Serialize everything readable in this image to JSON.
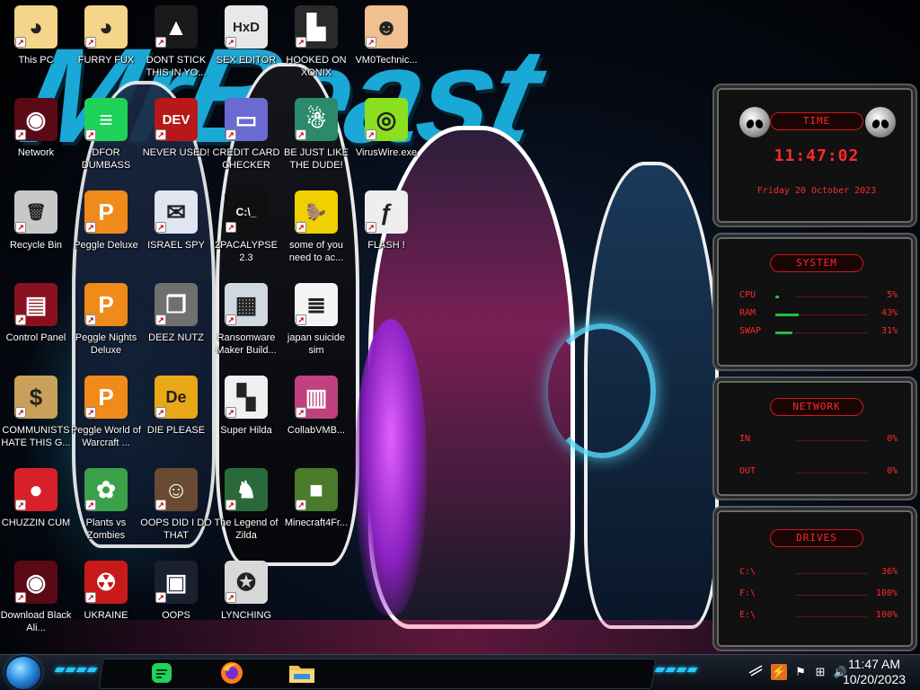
{
  "wallpaper": {
    "title_text": "MrBeast"
  },
  "desktop_icons": [
    {
      "id": "this-pc",
      "label": "This PC",
      "icon": "cartoon-face-icon",
      "col": 0,
      "row": 0
    },
    {
      "id": "network",
      "label": "Network",
      "icon": "alienware-orb-icon",
      "col": 0,
      "row": 1
    },
    {
      "id": "recycle-bin",
      "label": "Recycle Bin",
      "icon": "trash-can-icon",
      "col": 0,
      "row": 2
    },
    {
      "id": "control-panel",
      "label": "Control Panel",
      "icon": "control-panel-icon",
      "col": 0,
      "row": 3
    },
    {
      "id": "communists",
      "label": "COMMUNISTS HATE THIS G...",
      "icon": "money-bag-icon",
      "col": 0,
      "row": 4
    },
    {
      "id": "chuzzin-cum",
      "label": "CHUZZIN CUM",
      "icon": "red-fuzzball-icon",
      "col": 0,
      "row": 5
    },
    {
      "id": "download-black-ali",
      "label": "Download Black Ali...",
      "icon": "alienware-orb-icon",
      "col": 0,
      "row": 6
    },
    {
      "id": "furry-fux",
      "label": "FURRY FUX",
      "icon": "cartoon-face-icon",
      "col": 1,
      "row": 0
    },
    {
      "id": "dfor-dumbass",
      "label": "DFOR DUMBASS",
      "icon": "green-chat-icon",
      "col": 1,
      "row": 1
    },
    {
      "id": "peggle-deluxe",
      "label": "Peggle Deluxe",
      "icon": "peggle-icon",
      "col": 1,
      "row": 2
    },
    {
      "id": "peggle-nights",
      "label": "Peggle Nights Deluxe",
      "icon": "peggle-icon",
      "col": 1,
      "row": 3
    },
    {
      "id": "peggle-world",
      "label": "Peggle World of Warcraft ...",
      "icon": "peggle-icon",
      "col": 1,
      "row": 4
    },
    {
      "id": "plants-vs-zombies",
      "label": "Plants vs Zombies",
      "icon": "flower-icon",
      "col": 1,
      "row": 5
    },
    {
      "id": "ukraine",
      "label": "UKRAINE",
      "icon": "radiation-icon",
      "col": 1,
      "row": 6
    },
    {
      "id": "dont-stick",
      "label": "DONT STICK THIS IN YO...",
      "icon": "traffic-cone-icon",
      "col": 2,
      "row": 0
    },
    {
      "id": "never-used",
      "label": "NEVER USED!",
      "icon": "dev-cpp-icon",
      "col": 2,
      "row": 1
    },
    {
      "id": "israel-spy",
      "label": "ISRAEL SPY",
      "icon": "envelope-icon",
      "col": 2,
      "row": 2
    },
    {
      "id": "deez-nutz",
      "label": "DEEZ NUTZ",
      "icon": "stacked-windows-icon",
      "col": 2,
      "row": 3
    },
    {
      "id": "die-please",
      "label": "DIE PLEASE",
      "icon": "de-icon",
      "col": 2,
      "row": 4
    },
    {
      "id": "oops-did-i",
      "label": "OOPS DID I DO THAT",
      "icon": "portrait-icon",
      "col": 2,
      "row": 5
    },
    {
      "id": "oops",
      "label": "OOPS",
      "icon": "monitor-icon",
      "col": 2,
      "row": 6
    },
    {
      "id": "sex-editor",
      "label": "SEX EDITOR",
      "icon": "hxd-icon",
      "col": 3,
      "row": 0
    },
    {
      "id": "credit-card",
      "label": "CREDIT CARD CHECKER",
      "icon": "credit-card-icon",
      "col": 3,
      "row": 1
    },
    {
      "id": "2pacalypse",
      "label": "2PACALYPSE 2.3",
      "icon": "terminal-icon",
      "col": 3,
      "row": 2
    },
    {
      "id": "ransomware",
      "label": "Ransomware Maker Build...",
      "icon": "window-app-icon",
      "col": 3,
      "row": 3
    },
    {
      "id": "super-hilda",
      "label": "Super Hilda",
      "icon": "pixel-art-icon",
      "col": 3,
      "row": 4
    },
    {
      "id": "legend-of-zilda",
      "label": "The Legend of Zilda",
      "icon": "pixel-hero-icon",
      "col": 3,
      "row": 5
    },
    {
      "id": "lynching",
      "label": "LYNCHING",
      "icon": "cat-face-icon",
      "col": 3,
      "row": 6
    },
    {
      "id": "hooked-on-xonix",
      "label": "HOOKED ON XONIX",
      "icon": "xonix-icon",
      "col": 4,
      "row": 0
    },
    {
      "id": "be-just-like",
      "label": "BE JUST LIKE THE DUDE!",
      "icon": "santa-icon",
      "col": 4,
      "row": 1
    },
    {
      "id": "some-of-you",
      "label": "some of you need to ac...",
      "icon": "beaver-icon",
      "col": 4,
      "row": 2
    },
    {
      "id": "japan-suicide",
      "label": "japan suicide sim",
      "icon": "document-icon",
      "col": 4,
      "row": 3
    },
    {
      "id": "collabvmb",
      "label": "CollabVMB...",
      "icon": "monitor-stack-icon",
      "col": 4,
      "row": 4
    },
    {
      "id": "minecraft4",
      "label": "Minecraft4Fr...",
      "icon": "grass-block-icon",
      "col": 4,
      "row": 5
    },
    {
      "id": "vm0technic",
      "label": "VM0Technic...",
      "icon": "doctor-icon",
      "col": 5,
      "row": 0
    },
    {
      "id": "viruswire",
      "label": "VirusWire.exe",
      "icon": "lime-icon",
      "col": 5,
      "row": 1
    },
    {
      "id": "flash",
      "label": "FLASH !",
      "icon": "flash-document-icon",
      "col": 5,
      "row": 2
    }
  ],
  "gadget": {
    "time": {
      "header": "TIME",
      "clock": "11:47:02",
      "date": "Friday 20 October 2023"
    },
    "system": {
      "header": "SYSTEM",
      "rows": [
        {
          "key": "CPU",
          "value": "5%",
          "fraction": 0.05
        },
        {
          "key": "RAM",
          "value": "43%",
          "fraction": 0.43
        },
        {
          "key": "SWAP",
          "value": "31%",
          "fraction": 0.31
        }
      ]
    },
    "network": {
      "header": "NETWORK",
      "rows": [
        {
          "key": "IN",
          "value": "0%"
        },
        {
          "key": "OUT",
          "value": "0%"
        }
      ]
    },
    "drives": {
      "header": "DRIVES",
      "rows": [
        {
          "key": "C:\\",
          "value": "36%"
        },
        {
          "key": "F:\\",
          "value": "100%"
        },
        {
          "key": "E:\\",
          "value": "100%"
        }
      ]
    }
  },
  "taskbar": {
    "pinned": [
      {
        "name": "chat-app",
        "icon": "green-chat-icon"
      },
      {
        "name": "firefox",
        "icon": "firefox-icon"
      },
      {
        "name": "file-explorer",
        "icon": "folder-icon"
      }
    ],
    "tray": [
      {
        "name": "lightning-icon",
        "glyph": "⚡"
      },
      {
        "name": "flag-error-icon",
        "glyph": "⚑"
      },
      {
        "name": "network-icon",
        "glyph": "⊞"
      },
      {
        "name": "volume-icon",
        "glyph": "🔊"
      }
    ],
    "clock_time": "11:47 AM",
    "clock_date": "10/20/2023"
  },
  "colors": {
    "gadget_red": "#ff2a2a",
    "taskbar_accent": "#25c8ff"
  }
}
